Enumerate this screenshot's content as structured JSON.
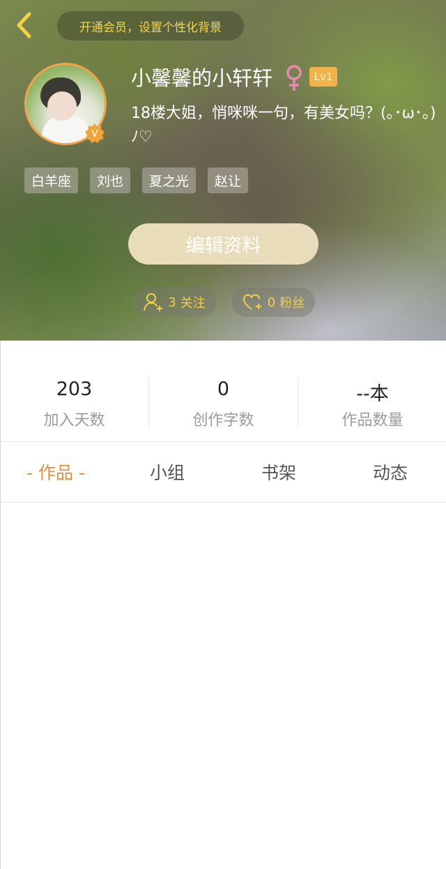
{
  "header": {
    "back_icon": "chevron-left-icon",
    "vip_prompt": "开通会员，设置个性化背景"
  },
  "profile": {
    "name": "小馨馨的小轩轩",
    "gender_symbol": "♀",
    "gender_color": "#e88ab4",
    "level": "Lv1",
    "verified_badge": "V",
    "bio": "18楼大姐，悄咪咪一句，有美女吗？(｡･ω･｡)ﾉ♡",
    "tags": [
      "白羊座",
      "刘也",
      "夏之光",
      "赵让"
    ],
    "edit_button": "编辑资料",
    "follow": {
      "count": "3",
      "label": "关注"
    },
    "fans": {
      "count": "0",
      "label": "粉丝"
    }
  },
  "stats": [
    {
      "value": "203",
      "label": "加入天数"
    },
    {
      "value": "0",
      "label": "创作字数"
    },
    {
      "value": "--本",
      "label": "作品数量"
    }
  ],
  "tabs": [
    {
      "label": "- 作品 -",
      "active": true
    },
    {
      "label": "小组",
      "active": false
    },
    {
      "label": "书架",
      "active": false
    },
    {
      "label": "动态",
      "active": false
    }
  ],
  "colors": {
    "accent": "#e98d3f",
    "gold_text": "#f3cf48",
    "level_badge": "#f3b14a",
    "edit_button_bg": "#e8dcba"
  }
}
